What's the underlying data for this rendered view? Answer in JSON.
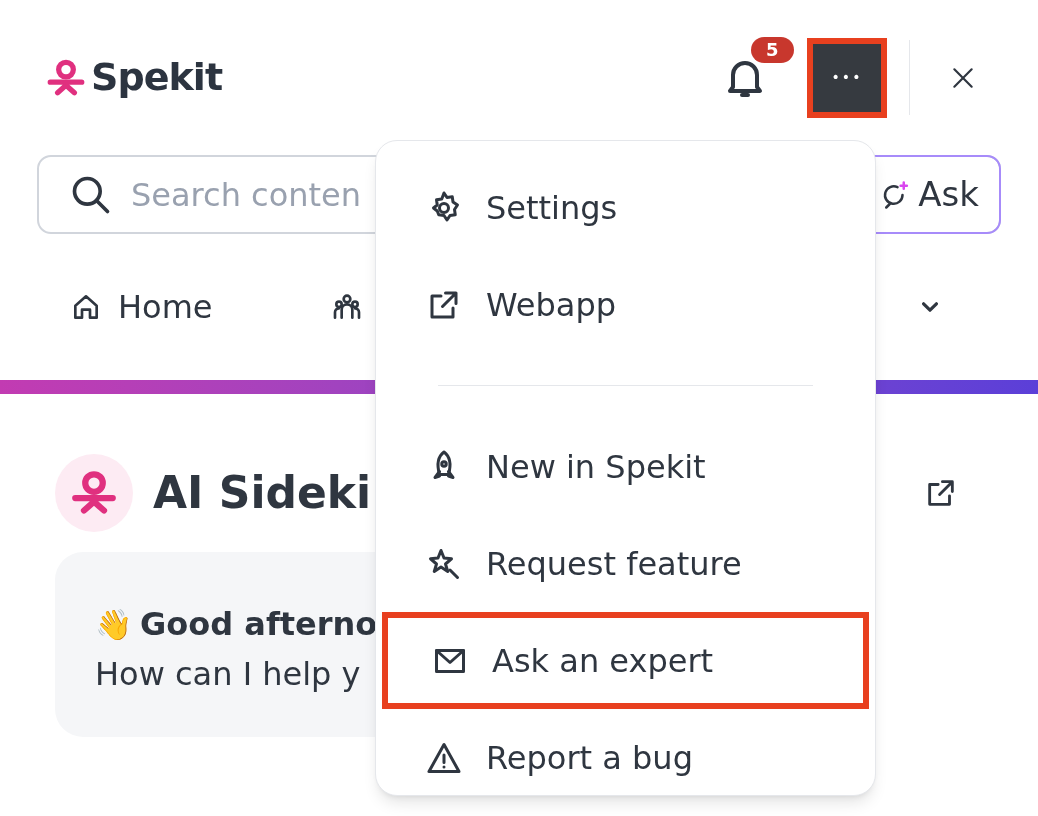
{
  "header": {
    "logo": "Spekit",
    "notification_count": "5",
    "more_button": {
      "label": "•••",
      "highlighted": true
    }
  },
  "search": {
    "placeholder": "Search conten",
    "ask_button": "Ask"
  },
  "nav": [
    {
      "label": "Home"
    }
  ],
  "sidekick": {
    "title": "AI Sideki",
    "greeting_emoji": "👋",
    "greeting": "Good afterno",
    "prompt": "How can I help y"
  },
  "menu": [
    {
      "kind": "item",
      "label": "Settings",
      "highlighted": false
    },
    {
      "kind": "item",
      "label": "Webapp",
      "highlighted": false
    },
    {
      "kind": "divider"
    },
    {
      "kind": "item",
      "label": "New in Spekit",
      "highlighted": false
    },
    {
      "kind": "item",
      "label": "Request feature",
      "highlighted": false
    },
    {
      "kind": "item",
      "label": "Ask an expert",
      "highlighted": true
    },
    {
      "kind": "item",
      "label": "Report a bug",
      "highlighted": false
    }
  ]
}
